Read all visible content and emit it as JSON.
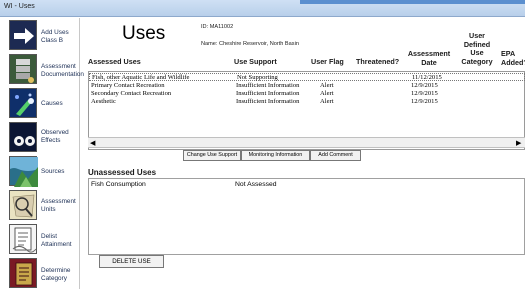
{
  "window": {
    "title": "WI - Uses"
  },
  "sidebar": {
    "items": [
      {
        "label": "Add Uses Class B",
        "icon": "arrow-icon"
      },
      {
        "label": "Assessment Documentation",
        "icon": "documents-icon"
      },
      {
        "label": "Causes",
        "icon": "causes-icon"
      },
      {
        "label": "Observed Effects",
        "icon": "observed-effects-icon"
      },
      {
        "label": "Sources",
        "icon": "sources-icon"
      },
      {
        "label": "Assessment Units",
        "icon": "assessment-units-icon"
      },
      {
        "label": "Delist Attainment",
        "icon": "delist-icon"
      },
      {
        "label": "Determine Category",
        "icon": "determine-category-icon"
      }
    ]
  },
  "header": {
    "title": "Uses",
    "id_line": "ID: MA11002",
    "name_line": "Name: Cheshire Reservoir, North Basin"
  },
  "assessed": {
    "columns": {
      "uses": "Assessed Uses",
      "support": "Use Support",
      "flag": "User Flag",
      "threatened": "Threatened?",
      "date_1": "Assessment",
      "date_2": "Date",
      "category_1": "User",
      "category_2": "Defined",
      "category_3": "Use",
      "category_4": "Category",
      "epa_1": "EPA",
      "epa_2": "Added?"
    },
    "rows": [
      {
        "use": "Fish, other Aquatic Life and Wildlife",
        "support": "Not Supporting",
        "flag": "",
        "date": "11/12/2015"
      },
      {
        "use": "Primary Contact Recreation",
        "support": "Insufficient Information",
        "flag": "Alert",
        "date": "12/9/2015"
      },
      {
        "use": "Secondary Contact Recreation",
        "support": "Insufficient Information",
        "flag": "Alert",
        "date": "12/9/2015"
      },
      {
        "use": "Aesthetic",
        "support": "Insufficient Information",
        "flag": "Alert",
        "date": "12/9/2015"
      }
    ]
  },
  "buttons": {
    "change_use_support": "Change Use Support",
    "monitoring_information": "Monitoring Information",
    "add_comment": "Add Comment",
    "delete_use": "DELETE USE"
  },
  "unassessed": {
    "heading": "Unassessed Uses",
    "rows": [
      {
        "use": "Fish Consumption",
        "status": "Not Assessed"
      }
    ]
  },
  "scroll": {
    "left_arrow": "◀",
    "right_arrow": "▶"
  }
}
